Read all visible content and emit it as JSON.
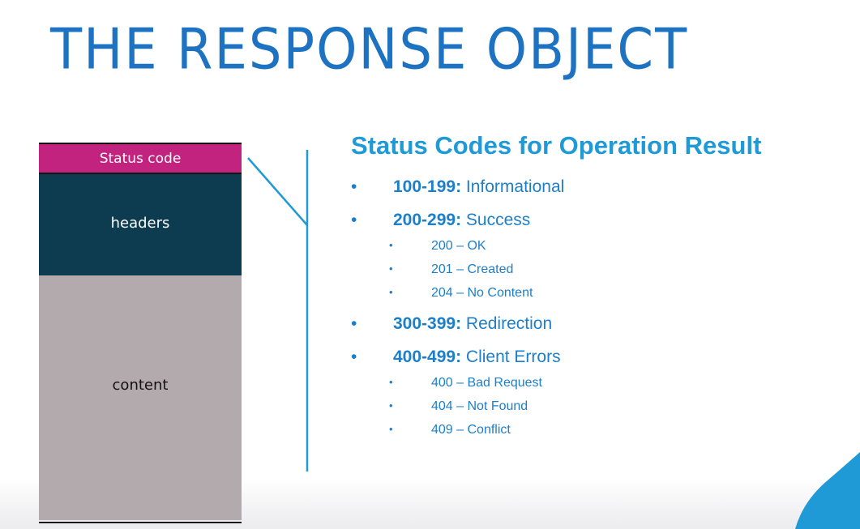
{
  "slide": {
    "title": "THE RESPONSE OBJECT"
  },
  "diagram": {
    "status_label": "Status code",
    "headers_label": "headers",
    "content_label": "content",
    "colors": {
      "status": "#c2237f",
      "headers": "#0d3b50",
      "content": "#b3aaad",
      "connector": "#1f9ad6"
    }
  },
  "status_codes": {
    "heading": "Status Codes for Operation Result",
    "bullet": "•",
    "groups": [
      {
        "range": "100-199:",
        "name": "Informational",
        "codes": []
      },
      {
        "range": "200-299:",
        "name": "Success",
        "codes": [
          "200 – OK",
          "201 – Created",
          "204 – No Content"
        ]
      },
      {
        "range": "300-399:",
        "name": "Redirection",
        "codes": []
      },
      {
        "range": "400-499:",
        "name": "Client Errors",
        "codes": [
          "400 – Bad Request",
          "404 – Not Found",
          "409 – Conflict"
        ]
      }
    ]
  }
}
